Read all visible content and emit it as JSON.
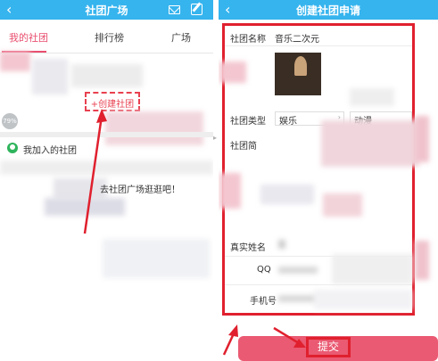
{
  "left_screen": {
    "header": {
      "title": "社团广场",
      "back_icon": "chevron-left-icon",
      "mail_icon": "mail-icon",
      "edit_icon": "edit-icon",
      "bg_color": "#36b4ee"
    },
    "tabs": [
      {
        "label": "我的社团",
        "active": true
      },
      {
        "label": "排行榜"
      },
      {
        "label": "广场"
      }
    ],
    "accent_color": "#e94f6f",
    "create_button": "+创建社团",
    "progress_badge": "79%",
    "joined_section": "我加入的社团",
    "empty_message": "去社团广场逛逛吧！"
  },
  "right_screen": {
    "header": {
      "title": "创建社团申请",
      "back_icon": "chevron-left-icon"
    },
    "form": {
      "name_label": "社团名称",
      "name_value": "音乐二次元",
      "type_label": "社团类型",
      "type_primary": "娱乐",
      "type_secondary": "动漫",
      "intro_label": "社团简",
      "realname_label": "真实姓名",
      "qq_label": "QQ",
      "phone_label": "手机号"
    },
    "submit_label": "提交",
    "highlight_color": "#e0202e"
  }
}
